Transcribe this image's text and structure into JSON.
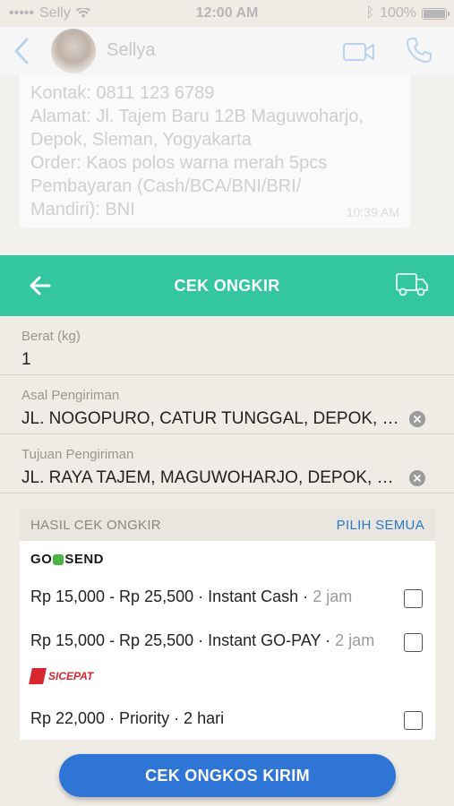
{
  "status_bar": {
    "carrier": "Selly",
    "time": "12:00 AM",
    "battery": "100%"
  },
  "chat": {
    "contact_name": "Sellya",
    "message_lines": [
      "Kontak: 0811 123 6789",
      "Alamat: Jl. Tajem Baru 12B Maguwoharjo,",
      "Depok, Sleman, Yogyakarta",
      "Order: Kaos polos warna merah 5pcs",
      "Pembayaran (Cash/BCA/BNI/BRI/",
      "Mandiri): BNI"
    ],
    "message_time": "10:39 AM"
  },
  "toolbar": {
    "title": "CEK ONGKIR"
  },
  "form": {
    "weight_label": "Berat (kg)",
    "weight_value": "1",
    "origin_label": "Asal Pengiriman",
    "origin_value": "JL. NOGOPURO, CATUR TUNGGAL, DEPOK, K...",
    "destination_label": "Tujuan Pengiriman",
    "destination_value": "JL. RAYA TAJEM, MAGUWOHARJO, DEPOK, K..."
  },
  "results": {
    "header_title": "HASIL CEK ONGKIR",
    "select_all": "PILIH SEMUA",
    "providers": [
      {
        "logo_text": "GO SEND",
        "options": [
          {
            "text": "Rp 15,000 - Rp 25,500 · Instant Cash · ",
            "duration": "2 jam",
            "checked": false
          },
          {
            "text": "Rp 15,000 - Rp 25,500 · Instant GO-PAY · ",
            "duration": "2 jam",
            "checked": false
          }
        ]
      },
      {
        "logo_text": "SICEPAT",
        "options": [
          {
            "text": "Rp 22,000 · Priority · 2 hari",
            "duration": "",
            "checked": false
          }
        ]
      }
    ]
  },
  "cta": {
    "label": "CEK ONGKOS KIRIM"
  },
  "colors": {
    "accent_green": "#34c6a0",
    "button_blue": "#2f75d6",
    "link_blue": "#2b78c5"
  }
}
